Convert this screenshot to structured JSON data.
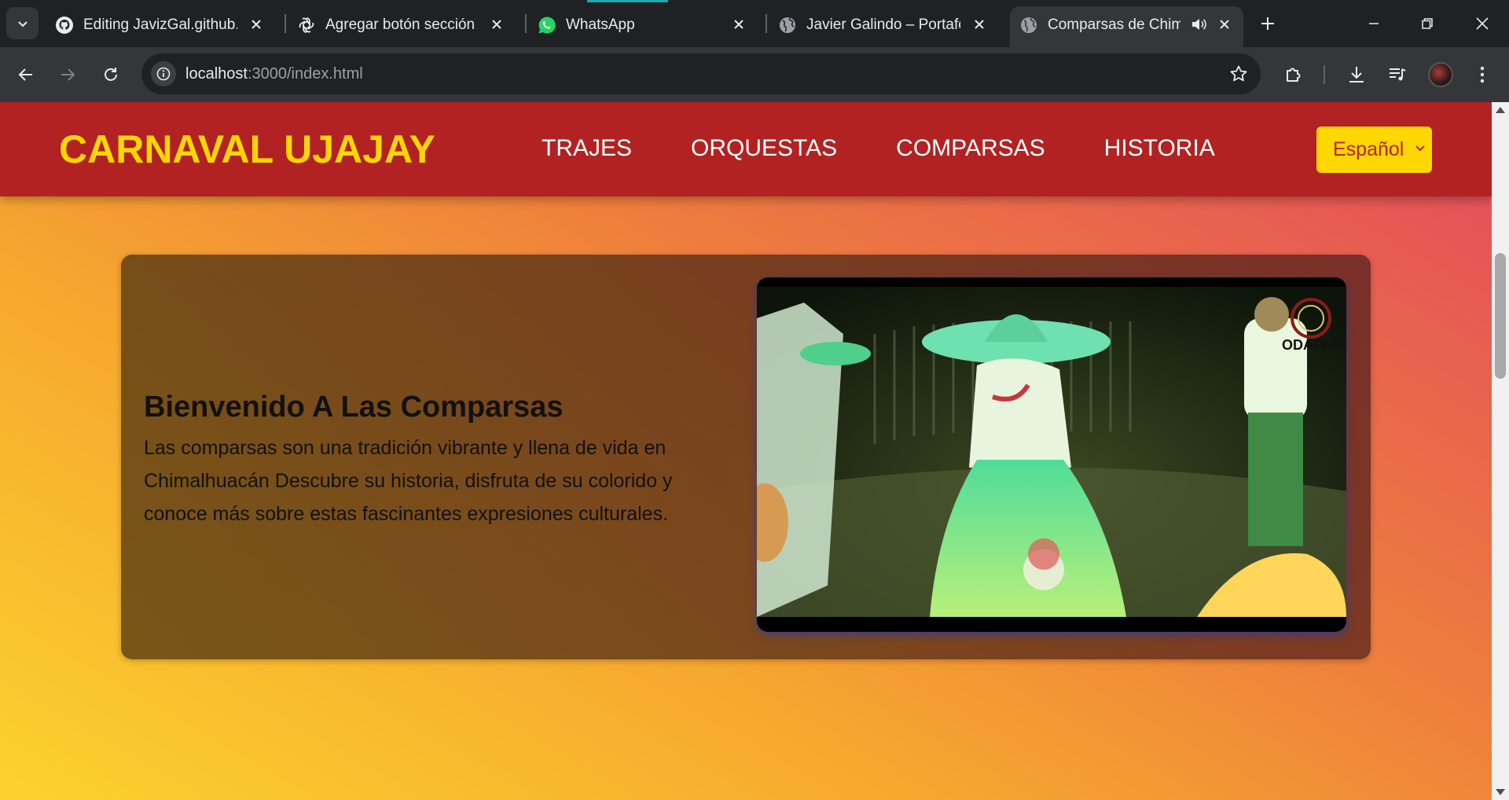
{
  "browser": {
    "tabs": [
      {
        "title": "Editing JavizGal.github.io",
        "icon": "github-icon"
      },
      {
        "title": "Agregar botón sección",
        "icon": "openai-icon"
      },
      {
        "title": "WhatsApp",
        "icon": "whatsapp-icon"
      },
      {
        "title": "Javier Galindo – Portafolio",
        "icon": "globe-icon"
      },
      {
        "title": "Comparsas de Chimalhuacán",
        "icon": "globe-icon",
        "active": true,
        "audio": true
      }
    ],
    "url_host": "localhost",
    "url_path": ":3000/index.html"
  },
  "site": {
    "brand": "CARNAVAL UJAJAY",
    "nav": [
      "TRAJES",
      "ORQUESTAS",
      "COMPARSAS",
      "HISTORIA"
    ],
    "language": "Español",
    "colors": {
      "header": "#b22222",
      "brand": "#ffd700",
      "button": "#ffd700"
    }
  },
  "hero": {
    "title": "Bienvenido A Las Comparsas",
    "text": "Las comparsas son una tradición vibrante y llena de vida en Chimalhuacán Descubre su historia, disfruta de su colorido y conoce más sobre estas fascinantes expresiones culturales.",
    "video_watermark": "ODAPAS"
  }
}
